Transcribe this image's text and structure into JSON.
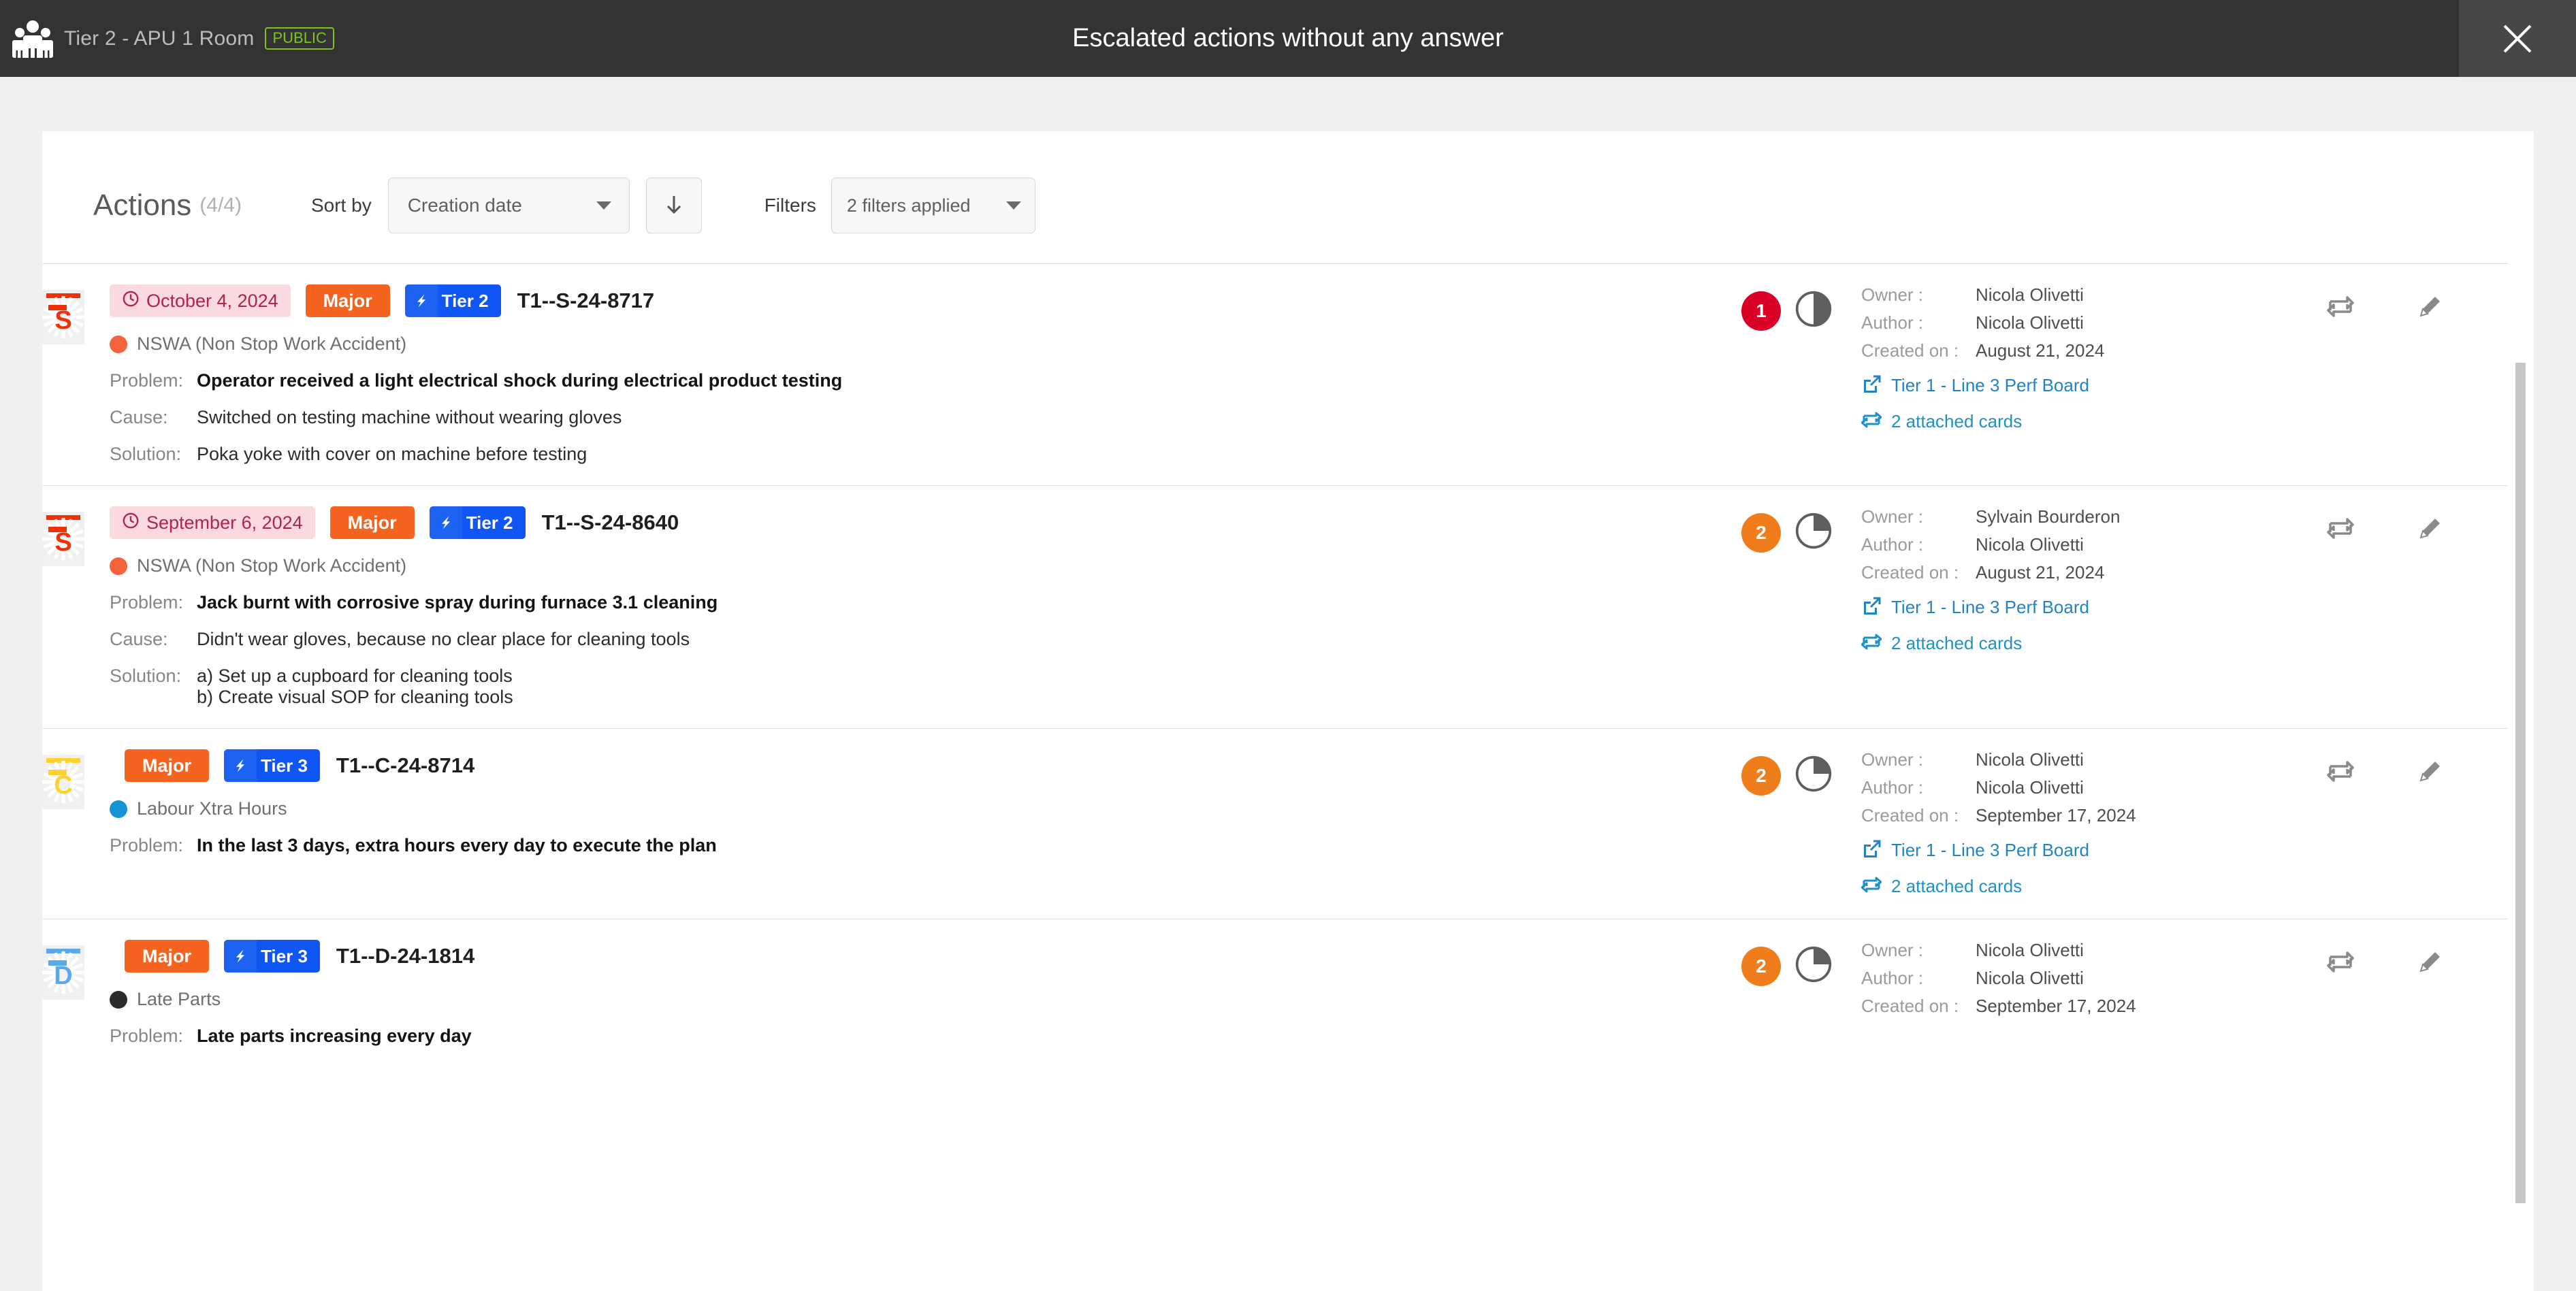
{
  "topbar": {
    "room_title": "Tier 2 - APU 1 Room",
    "visibility_badge": "PUBLIC",
    "modal_title": "Escalated actions without any answer",
    "close_icon": "close-icon",
    "people_icon": "people-group-icon",
    "accent_public": "#7ac520",
    "bar_bg": "#333333"
  },
  "toolbar": {
    "title": "Actions",
    "count": "(4/4)",
    "sort_by_label": "Sort by",
    "sort_value": "Creation date",
    "sort_direction_icon": "arrow-down-icon",
    "filters_label": "Filters",
    "filters_value": "2 filters applied"
  },
  "meta_labels": {
    "owner": "Owner :",
    "author": "Author :",
    "created_on": "Created on :",
    "problem": "Problem:",
    "cause": "Cause:",
    "solution": "Solution:"
  },
  "colors": {
    "major": "#f4641e",
    "tier_blue": "#0f56f5",
    "date_chip_bg": "#fadadf",
    "date_chip_fg": "#b0234a",
    "badge_red": "#d80027",
    "badge_orange": "#ef7d1c",
    "link_blue": "#2284c5"
  },
  "rows": [
    {
      "type_letter": "S",
      "type_color": "#f23005",
      "date": "October 4, 2024",
      "has_date": true,
      "severity": "Major",
      "tier": "Tier 2",
      "ref": "T1--S-24-8717",
      "category": "NSWA (Non Stop Work Accident)",
      "category_color": "#f4643c",
      "problem": "Operator received a light electrical shock during electrical product testing",
      "cause": "Switched on testing machine without wearing gloves",
      "solution": "Poka yoke with cover on machine before testing",
      "solution_b": "",
      "count": "1",
      "count_color": "#d80027",
      "progress": 50,
      "owner": "Nicola Olivetti",
      "author": "Nicola Olivetti",
      "created_on": "August 21, 2024",
      "board_link": "Tier 1 - Line 3 Perf Board",
      "attached_cards": "2 attached cards"
    },
    {
      "type_letter": "S",
      "type_color": "#f23005",
      "date": "September 6, 2024",
      "has_date": true,
      "severity": "Major",
      "tier": "Tier 2",
      "ref": "T1--S-24-8640",
      "category": "NSWA (Non Stop Work Accident)",
      "category_color": "#f4643c",
      "problem": "Jack burnt with corrosive spray during furnace 3.1 cleaning",
      "cause": "Didn't wear gloves, because no clear place for cleaning tools",
      "solution": "a) Set up a cupboard for cleaning tools",
      "solution_b": "b) Create visual SOP for cleaning tools",
      "count": "2",
      "count_color": "#ef7d1c",
      "progress": 25,
      "owner": "Sylvain Bourderon",
      "author": "Nicola Olivetti",
      "created_on": "August 21, 2024",
      "board_link": "Tier 1 - Line 3 Perf Board",
      "attached_cards": "2 attached cards"
    },
    {
      "type_letter": "C",
      "type_color": "#ffd12e",
      "date": "",
      "has_date": false,
      "severity": "Major",
      "tier": "Tier 3",
      "ref": "T1--C-24-8714",
      "category": "Labour Xtra Hours",
      "category_color": "#1494d4",
      "problem": "In the last 3 days, extra hours every day to execute the plan",
      "cause": "",
      "solution": "",
      "solution_b": "",
      "count": "2",
      "count_color": "#ef7d1c",
      "progress": 25,
      "owner": "Nicola Olivetti",
      "author": "Nicola Olivetti",
      "created_on": "September 17, 2024",
      "board_link": "Tier 1 - Line 3 Perf Board",
      "attached_cards": "2 attached cards"
    },
    {
      "type_letter": "D",
      "type_color": "#5ca8e8",
      "date": "",
      "has_date": false,
      "severity": "Major",
      "tier": "Tier 3",
      "ref": "T1--D-24-1814",
      "category": "Late Parts",
      "category_color": "#2b2b2b",
      "problem": "Late parts increasing every day",
      "cause": "",
      "solution": "",
      "solution_b": "",
      "count": "2",
      "count_color": "#ef7d1c",
      "progress": 25,
      "owner": "Nicola Olivetti",
      "author": "Nicola Olivetti",
      "created_on": "September 17, 2024",
      "board_link": "",
      "attached_cards": ""
    }
  ],
  "tools": {
    "link_icon": "repeat-link-icon",
    "edit_icon": "pencil-icon",
    "delete_icon": "trash-icon"
  }
}
